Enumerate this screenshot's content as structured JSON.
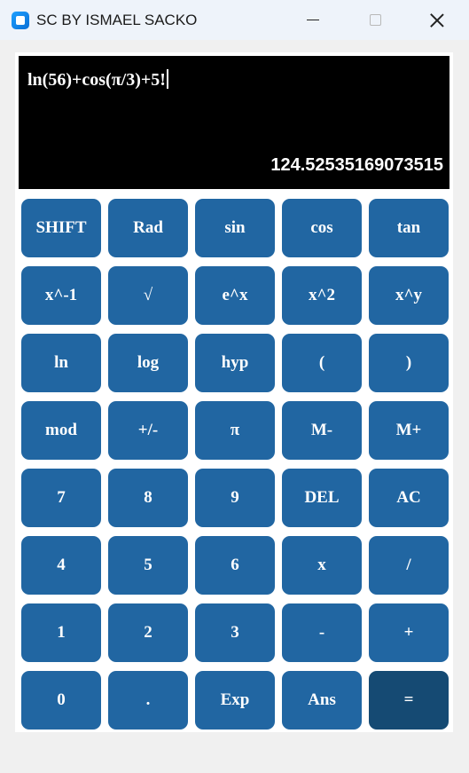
{
  "window": {
    "title": "SC BY ISMAEL SACKO",
    "icons": [
      "app-icon",
      "minimize-icon",
      "maximize-icon",
      "close-icon"
    ]
  },
  "display": {
    "expression": "ln(56)+cos(π/3)+5!",
    "result": "124.52535169073515"
  },
  "keys": [
    [
      "SHIFT",
      "Rad",
      "sin",
      "cos",
      "tan"
    ],
    [
      "x^-1",
      "√",
      "e^x",
      "x^2",
      "x^y"
    ],
    [
      "ln",
      "log",
      "hyp",
      "(",
      ")"
    ],
    [
      "mod",
      "+/-",
      "π",
      "M-",
      "M+"
    ],
    [
      "7",
      "8",
      "9",
      "DEL",
      "AC"
    ],
    [
      "4",
      "5",
      "6",
      "x",
      "/"
    ],
    [
      "1",
      "2",
      "3",
      "-",
      "+"
    ],
    [
      "0",
      ".",
      "Exp",
      "Ans",
      "="
    ]
  ],
  "colors": {
    "key": "#2166a2",
    "equals_key": "#154a73",
    "display_bg": "#000000",
    "display_text": "#ffffff"
  }
}
